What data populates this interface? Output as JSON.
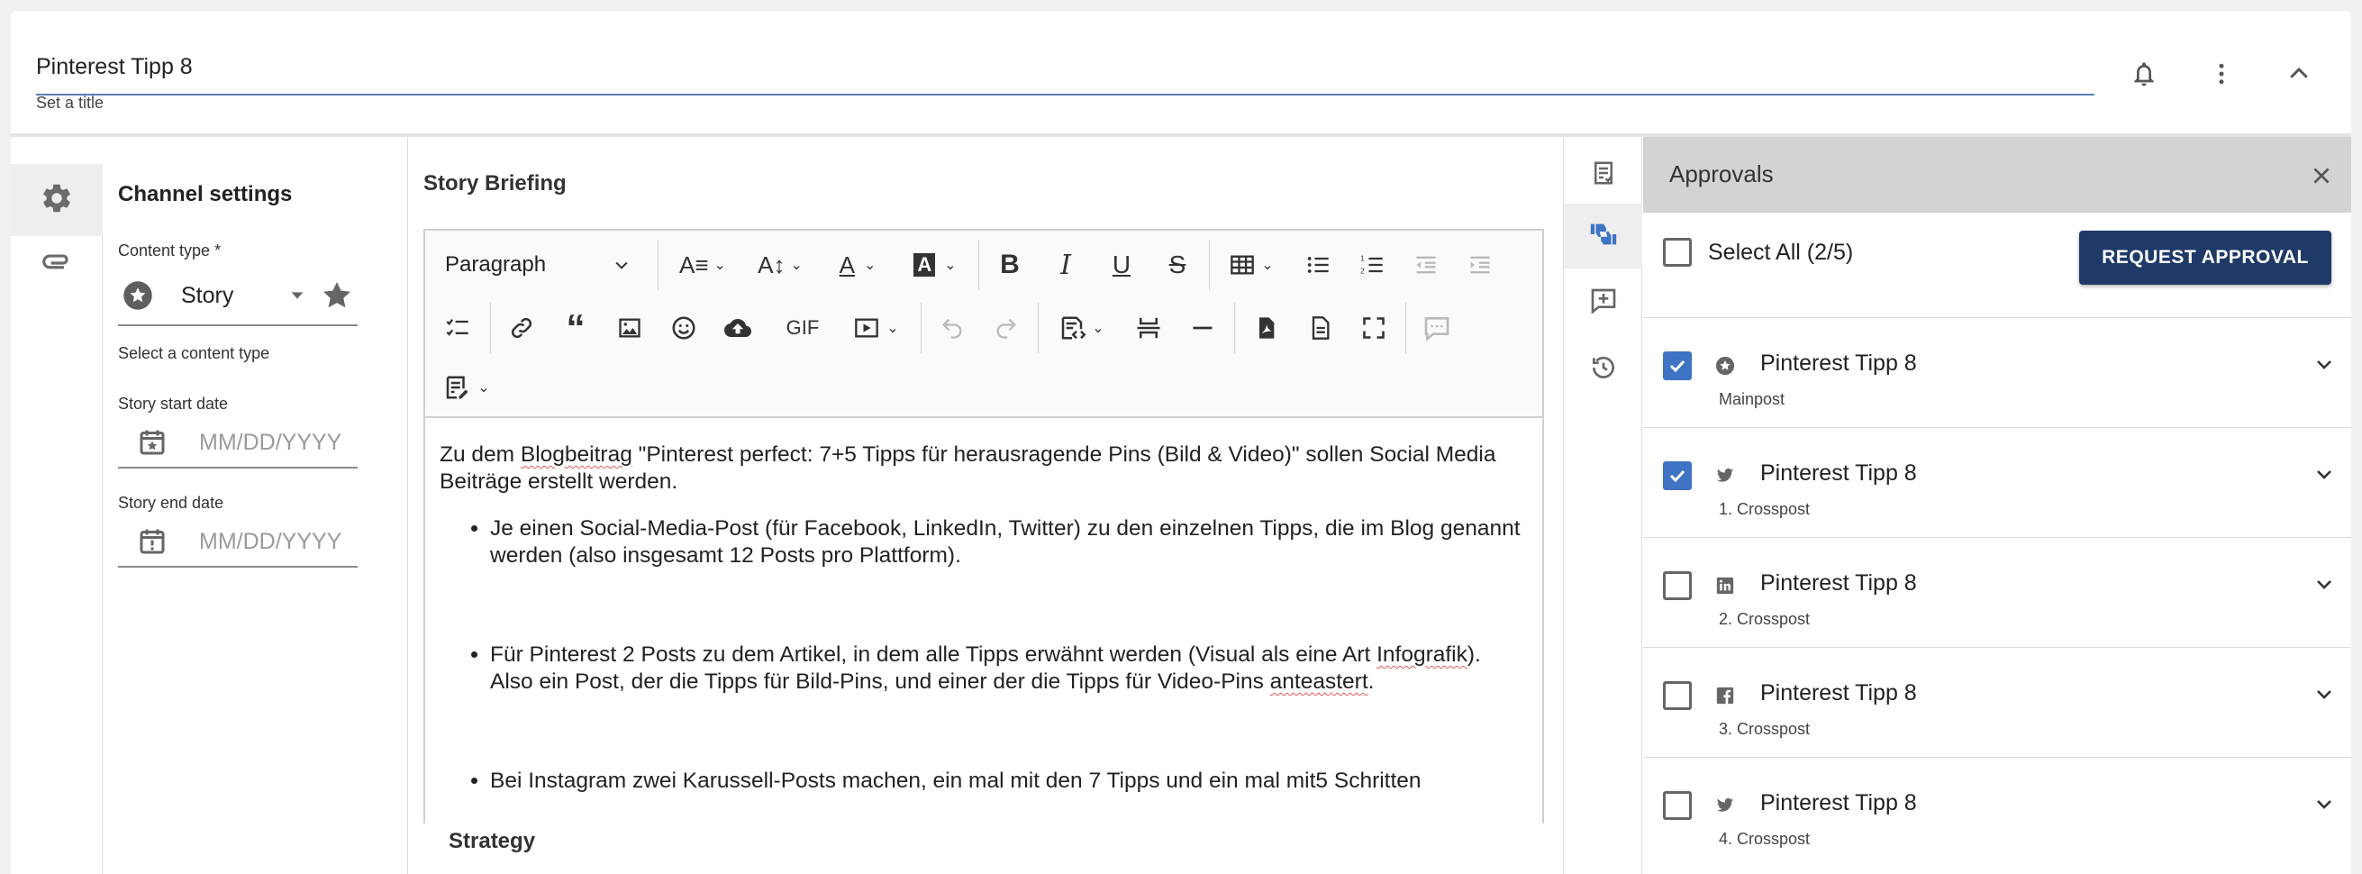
{
  "header": {
    "title_value": "Pinterest Tipp 8",
    "title_helper": "Set a title",
    "icons": [
      "bell-icon",
      "more-vert-icon",
      "chevron-up-icon"
    ]
  },
  "rail": {
    "items": [
      "gear-icon",
      "paperclip-icon"
    ]
  },
  "channel_settings": {
    "heading": "Channel settings",
    "content_type_label": "Content type *",
    "content_type_value": "Story",
    "content_type_helper": "Select a content type",
    "start_date_label": "Story start date",
    "start_date_placeholder": "MM/DD/YYYY",
    "end_date_label": "Story end date",
    "end_date_placeholder": "MM/DD/YYYY"
  },
  "editor": {
    "section_title": "Story Briefing",
    "block_format": "Paragraph",
    "gif_label": "GIF",
    "paragraph_1": {
      "part_a": "Zu dem ",
      "part_b": "Blogbeitrag",
      "part_c": " \"Pinterest perfect: 7+5 Tipps für herausragende Pins (Bild & Video)\" sollen Social Media Beiträge erstellt werden."
    },
    "bullet_1": "Je einen Social-Media-Post (für Facebook, LinkedIn, Twitter) zu den einzelnen Tipps, die im Blog genannt werden (also insgesamt 12 Posts pro Plattform).",
    "bullet_2": {
      "part_a": "Für Pinterest 2 Posts zu dem Artikel, in dem alle Tipps erwähnt werden (Visual als eine Art ",
      "part_b": "Infografik",
      "part_c": "). Also ein Post, der die Tipps für Bild-Pins, und einer der die Tipps für Video-Pins ",
      "part_d": "anteastert",
      "part_e": "."
    },
    "bullet_3": "Bei Instagram zwei Karussell-Posts machen, ein mal mit den 7 Tipps und ein mal mit5 Schritten",
    "next_section_title": "Strategy"
  },
  "side_strip": {
    "items": [
      "checklist-icon",
      "approval-thumbs-icon",
      "add-comment-icon",
      "history-icon"
    ]
  },
  "approvals": {
    "title": "Approvals",
    "select_all_label": "Select All (2/5)",
    "request_button": "REQUEST APPROVAL",
    "rows": [
      {
        "name": "Pinterest Tipp 8",
        "sub": "Mainpost",
        "checked": true,
        "channel_icon": "star-badge-icon"
      },
      {
        "name": "Pinterest Tipp 8",
        "sub": "1. Crosspost",
        "checked": true,
        "channel_icon": "twitter-icon"
      },
      {
        "name": "Pinterest Tipp 8",
        "sub": "2. Crosspost",
        "checked": false,
        "channel_icon": "linkedin-icon"
      },
      {
        "name": "Pinterest Tipp 8",
        "sub": "3. Crosspost",
        "checked": false,
        "channel_icon": "facebook-icon"
      },
      {
        "name": "Pinterest Tipp 8",
        "sub": "4. Crosspost",
        "checked": false,
        "channel_icon": "twitter-icon"
      }
    ]
  },
  "colors": {
    "primary_button": "#1f3a68",
    "checkbox_checked": "#3f73c3",
    "approvals_header": "#d3d3d3",
    "title_underline": "#5b7fb8"
  }
}
